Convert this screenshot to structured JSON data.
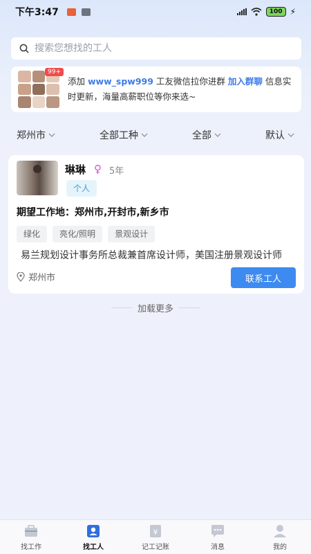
{
  "status_bar": {
    "time": "下午3:47",
    "battery": "100"
  },
  "search": {
    "placeholder": "搜索您想找的工人"
  },
  "banner": {
    "badge": "99+",
    "text_prefix": "添加",
    "wechat_id": "www_spw999",
    "text_middle": "工友微信拉你进群",
    "join_label": "加入群聊",
    "text_suffix": "信息实时更新，海量高薪职位等你来选~"
  },
  "filters": [
    {
      "label": "郑州市"
    },
    {
      "label": "全部工种"
    },
    {
      "label": "全部"
    },
    {
      "label": "默认"
    }
  ],
  "worker_card": {
    "name": "琳琳",
    "gender_icon": "female-icon",
    "years": "5年",
    "type": "个人",
    "expected_location": "期望工作地：郑州市,开封市,新乡市",
    "skills": [
      "绿化",
      "亮化/照明",
      "景观设计"
    ],
    "description": "易兰规划设计事务所总裁兼首席设计师，美国注册景观设计师",
    "location": "郑州市",
    "contact_label": "联系工人"
  },
  "load_more": "加载更多",
  "tabs": [
    {
      "label": "找工作",
      "icon": "briefcase-icon",
      "active": false
    },
    {
      "label": "找工人",
      "icon": "worker-id-icon",
      "active": true
    },
    {
      "label": "记工记账",
      "icon": "ledger-icon",
      "active": false
    },
    {
      "label": "消息",
      "icon": "message-icon",
      "active": false
    },
    {
      "label": "我的",
      "icon": "profile-icon",
      "active": false
    }
  ],
  "colors": {
    "accent": "#3d8af0",
    "highlight": "#3d7be8",
    "active_tab": "#2f6fe0"
  }
}
